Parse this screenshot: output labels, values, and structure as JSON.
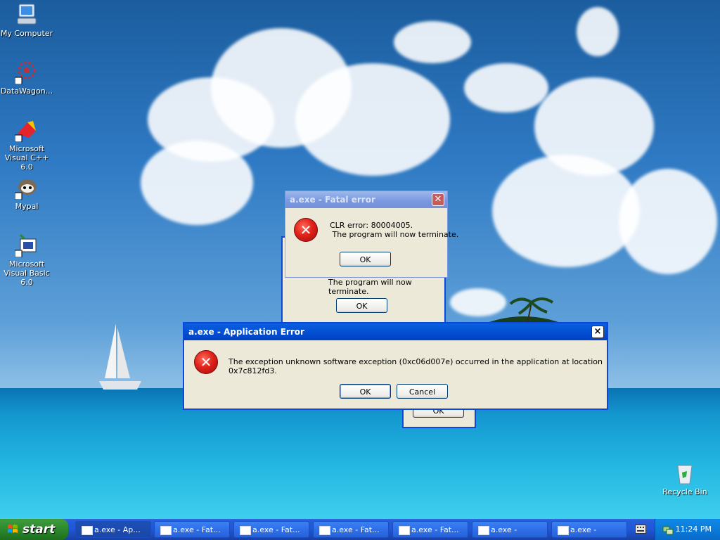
{
  "desktop": {
    "icons": [
      {
        "label": "My Computer",
        "icon": "my-computer-icon"
      },
      {
        "label": "DataWagon...",
        "icon": "datawagon-icon"
      },
      {
        "label": "Microsoft Visual C++ 6.0",
        "icon": "visual-cpp-icon"
      },
      {
        "label": "Mypal",
        "icon": "mypal-icon"
      },
      {
        "label": "Microsoft Visual Basic 6.0",
        "icon": "visual-basic-icon"
      },
      {
        "label": "Recycle Bin",
        "icon": "recycle-bin-icon"
      }
    ]
  },
  "dialogs": {
    "fatal_top": {
      "title": "a.exe - Fatal error",
      "line1": "CLR error: 80004005.",
      "line2": " The program will now terminate.",
      "ok": "OK"
    },
    "fatal_middle": {
      "line2": "The program will now terminate.",
      "ok": "OK"
    },
    "fatal_bottom": {
      "ok": "OK"
    },
    "app_error": {
      "title": "a.exe - Application Error",
      "message": "The exception unknown software exception (0xc06d007e) occurred in the application at location 0x7c812fd3.",
      "ok": "OK",
      "cancel": "Cancel",
      "close": "×"
    }
  },
  "taskbar": {
    "start_label": "start",
    "buttons": [
      "a.exe - Ap...",
      "a.exe - Fat...",
      "a.exe - Fat...",
      "a.exe - Fat...",
      "a.exe - Fat...",
      "a.exe -",
      "a.exe -"
    ],
    "clock": "11:24 PM"
  },
  "colors": {
    "title_active": "#0553d5",
    "title_inactive": "#7a96df",
    "dialog_bg": "#ece9d8",
    "error_red": "#e0231b",
    "start_green": "#2e8b2e"
  }
}
